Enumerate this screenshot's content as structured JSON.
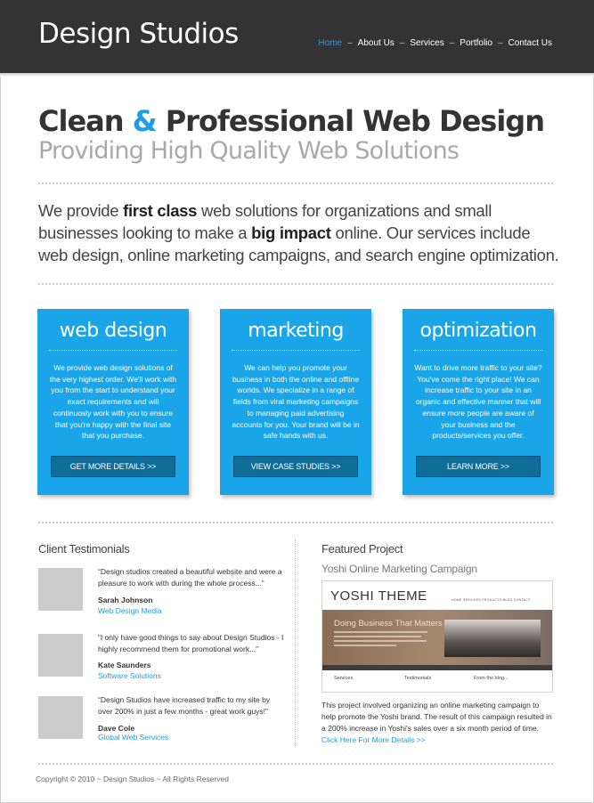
{
  "header": {
    "logo": "Design Studios",
    "nav": [
      {
        "label": "Home",
        "active": true
      },
      {
        "label": "About Us",
        "active": false
      },
      {
        "label": "Services",
        "active": false
      },
      {
        "label": "Portfolio",
        "active": false
      },
      {
        "label": "Contact Us",
        "active": false
      }
    ],
    "separator": "–"
  },
  "hero": {
    "headline_part1": "Clean ",
    "headline_amp": "&",
    "headline_part2": " Professional Web Design",
    "subhead": "Providing High Quality Web Solutions"
  },
  "intro": {
    "t1": "We provide ",
    "b1": "first class",
    "t2": " web solutions for organizations and small businesses looking to make a ",
    "b2": "big impact",
    "t3": " online. Our services include web design, online marketing campaigns, and search engine optimization."
  },
  "services": [
    {
      "title": "web design",
      "desc": "We provide web design solutions of the very highest order. We'll work with you from the start to understand your exact requirements and will continuosly work with you to ensure that you're happy with the final site that you purchase.",
      "button": "GET MORE DETAILS >>"
    },
    {
      "title": "marketing",
      "desc": "We can help you promote your business in both the online and offline worlds. We specialize in a range of fields from viral marketing campaigns to managing paid advertising accounts for you. Your brand will be in safe hands with us.",
      "button": "VIEW CASE STUDIES >>"
    },
    {
      "title": "optimization",
      "desc": "Want to drive more traffic to your site? You've come the right place! We can increase traffic to your site in an organic and effective manner that will ensure more people are aware of your business and the products/services you offer.",
      "button": "LEARN MORE >>"
    }
  ],
  "testimonials": {
    "title": "Client Testimonials",
    "items": [
      {
        "quote": "“Design studios created a beautiful website and were a pleasure to work with during the whole process...”",
        "name": "Sarah Johnson",
        "company": "Web Design Media"
      },
      {
        "quote": "“I only have good things to say about Design Studios - I highly recommend them for promotional work...”",
        "name": "Kate Saunders",
        "company": "Software Solutions"
      },
      {
        "quote": "“Design Studios have increased traffic to my site by over 200% in just a few months - great work guys!”",
        "name": "Dave Cole",
        "company": "Global Web Services"
      }
    ]
  },
  "featured": {
    "title": "Featured Project",
    "subtitle": "Yoshi Online Marketing Campaign",
    "screenshot": {
      "brand": "YOSHI THEME",
      "nav": "HOME   SERVICES   PRODUCTS   BLOG   CONTACT",
      "banner_title": "Doing Business That Matters",
      "col1": "Services",
      "col2": "Testimonials",
      "col3": "From the blog..."
    },
    "text": "This project involved organizing an online marketing campaign to help promote the Yoshi brand. The result of this campaign resulted in a 200% increase in Yoshi's sales over a six month period of time.",
    "link": "Click Here For More Details >>"
  },
  "footer": {
    "copyright": "Copyright © 2010 ~ Design Studios ~ All Rights Reserved"
  }
}
